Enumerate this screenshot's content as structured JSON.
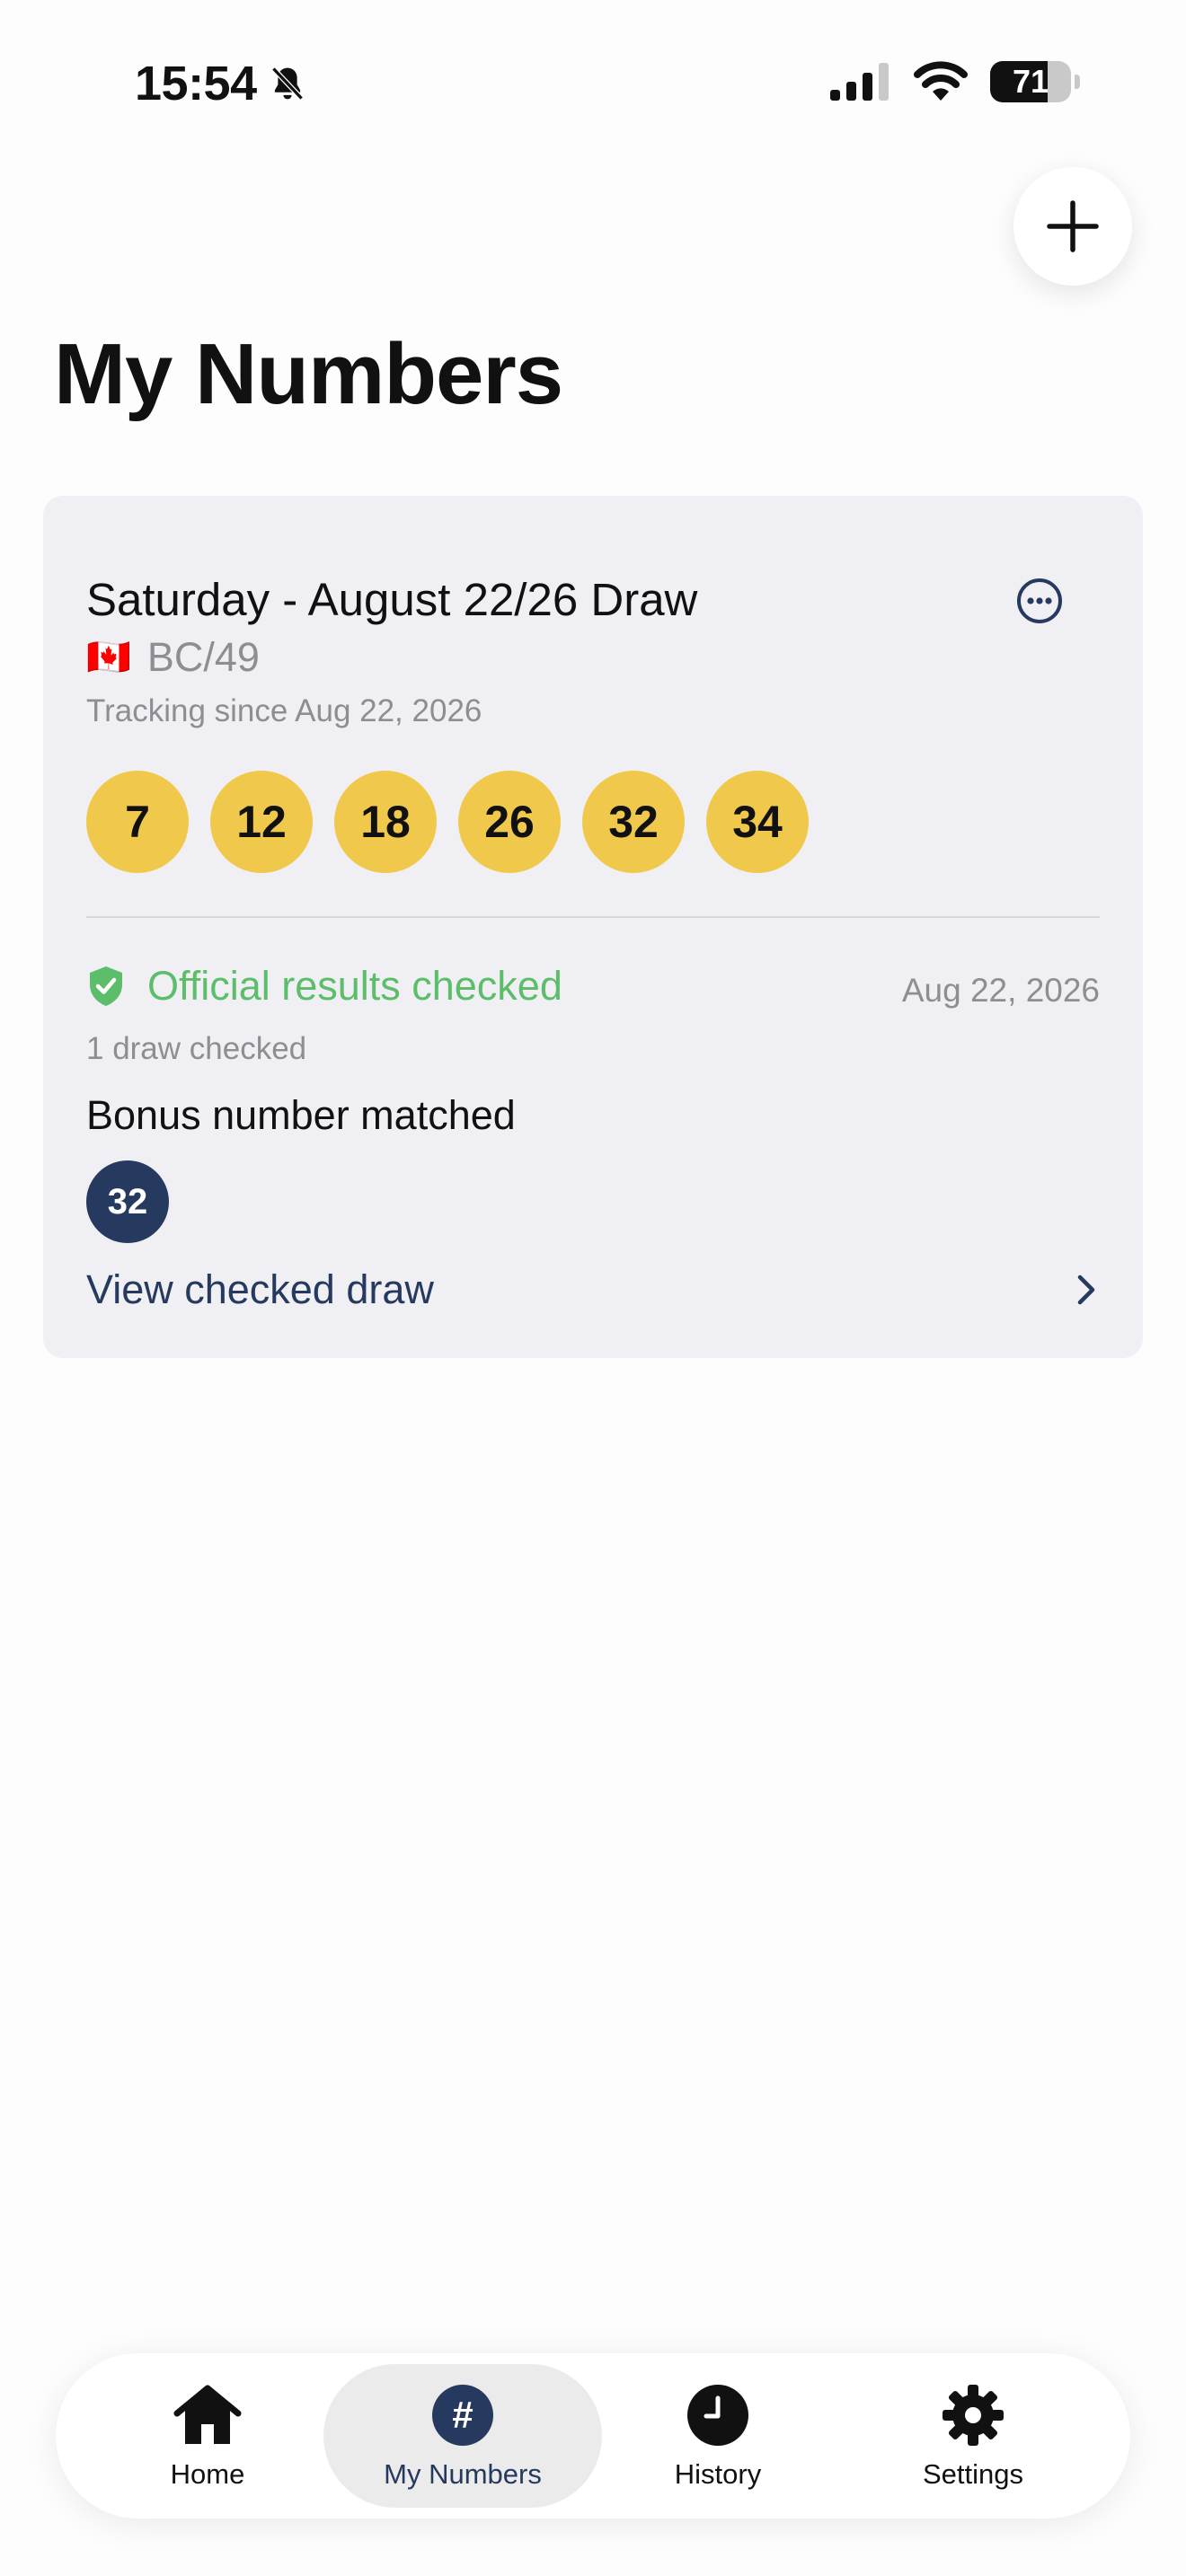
{
  "status_bar": {
    "time": "15:54",
    "battery_percent": "71",
    "battery_level": 0.71,
    "icons": [
      "bell-slash-icon",
      "cellular-signal-icon",
      "wifi-icon",
      "battery-icon"
    ]
  },
  "header": {
    "title": "My Numbers",
    "add_icon": "plus-icon"
  },
  "card": {
    "draw_title": "Saturday - August 22/26 Draw",
    "region_flag": "🇨🇦",
    "region": "BC/49",
    "tracking": "Tracking since Aug 22, 2026",
    "numbers": [
      "7",
      "12",
      "18",
      "26",
      "32",
      "34"
    ],
    "result_status": "Official results checked",
    "result_date": "Aug 22, 2026",
    "draws_checked": "1 draw checked",
    "bonus_label": "Bonus number matched",
    "bonus_number": "32",
    "view_link": "View checked draw"
  },
  "tabs": [
    {
      "label": "Home",
      "icon": "house-icon",
      "active": false
    },
    {
      "label": "My Numbers",
      "icon": "hash-icon",
      "active": true
    },
    {
      "label": "History",
      "icon": "clock-icon",
      "active": false
    },
    {
      "label": "Settings",
      "icon": "gear-icon",
      "active": false
    }
  ],
  "colors": {
    "ball_yellow": "#f0c94c",
    "navy": "#253a5e",
    "success_green": "#5cbd6a",
    "card_bg": "#f0f0f4",
    "muted_text": "#8d8d92"
  }
}
